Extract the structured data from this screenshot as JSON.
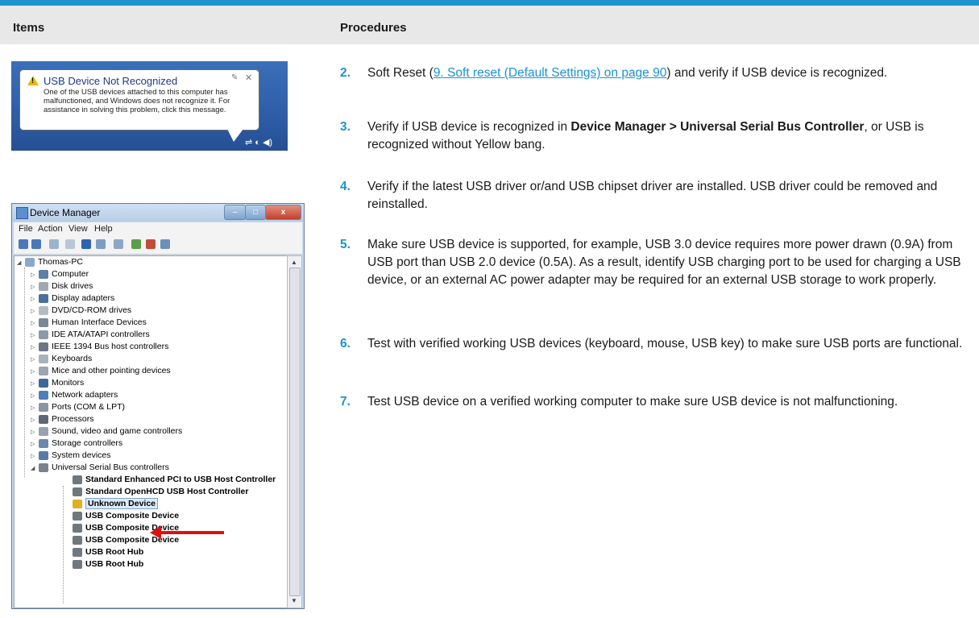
{
  "header": {
    "items_label": "Items",
    "procedures_label": "Procedures"
  },
  "balloon": {
    "title": "USB Device Not Recognized",
    "body": "One of the USB devices attached to this computer has malfunctioned, and Windows does not recognize it. For assistance in solving this problem, click this message."
  },
  "device_manager": {
    "title": "Device Manager",
    "menu": [
      "File",
      "Action",
      "View",
      "Help"
    ],
    "root": "Thomas-PC",
    "categories": [
      "Computer",
      "Disk drives",
      "Display adapters",
      "DVD/CD-ROM drives",
      "Human Interface Devices",
      "IDE ATA/ATAPI controllers",
      "IEEE 1394 Bus host controllers",
      "Keyboards",
      "Mice and other pointing devices",
      "Monitors",
      "Network adapters",
      "Ports (COM & LPT)",
      "Processors",
      "Sound, video and game controllers",
      "Storage controllers",
      "System devices",
      "Universal Serial Bus controllers"
    ],
    "usb_children": [
      "Standard Enhanced PCI to USB Host Controller",
      "Standard OpenHCD USB Host Controller",
      "Unknown Device",
      "USB Composite Device",
      "USB Composite Device",
      "USB Composite Device",
      "USB Root Hub",
      "USB Root Hub"
    ]
  },
  "steps": [
    {
      "num": "2.",
      "pre": "Soft Reset (",
      "link": "9. Soft reset (Default Settings) on page 90",
      "post": ") and verify if USB device is recognized."
    },
    {
      "num": "3.",
      "pre": "Verify if USB device is recognized in ",
      "bold": "Device Manager > Universal Serial Bus Controller",
      "post": ", or USB is recognized without Yellow bang."
    },
    {
      "num": "4.",
      "text": "Verify if the latest USB driver or/and USB chipset driver are installed. USB driver could be removed and reinstalled."
    },
    {
      "num": "5.",
      "text": "Make sure USB device is supported, for example, USB 3.0 device requires more power drawn (0.9A) from USB port than USB 2.0 device (0.5A). As a result, identify USB charging port to be used for charging a USB device, or an external AC power adapter may be required for an external USB storage to work properly."
    },
    {
      "num": "6.",
      "text": "Test with verified working USB devices (keyboard, mouse, USB key) to make sure USB ports are functional."
    },
    {
      "num": "7.",
      "text": "Test USB device on a verified working computer to make sure USB device is not malfunctioning."
    }
  ]
}
